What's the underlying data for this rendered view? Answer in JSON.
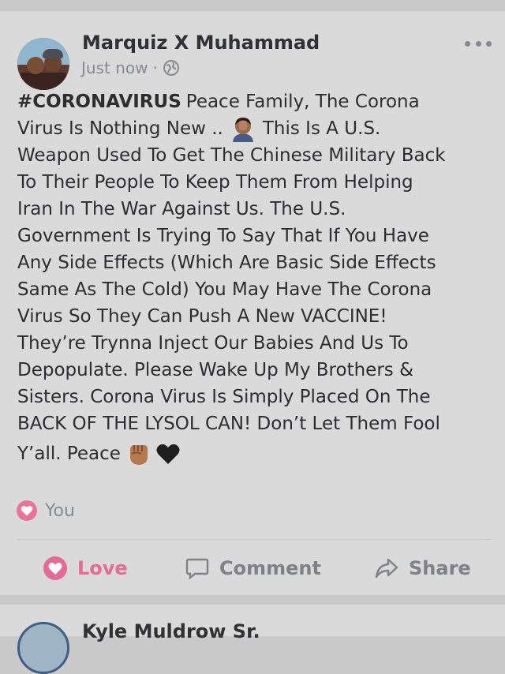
{
  "post": {
    "author": "Marquiz X Muhammad",
    "timestamp": "Just now",
    "separator": "·",
    "privacy_icon": "globe-icon",
    "more_icon": "more-options-icon",
    "hashtag": "#CORONAVIRUS",
    "lines": [
      "Peace Family, The Corona",
      "Virus Is Nothing New ..",
      "This Is A U.S.",
      "Weapon Used To Get The Chinese Military Back",
      "To Their People To Keep Them From Helping",
      "Iran In The War Against Us. The U.S.",
      "Government Is Trying To Say That If You Have",
      "Any Side Effects (Which Are Basic Side Effects",
      "Same As The Cold) You May Have The Corona",
      "Virus So They Can Push A New VACCINE!",
      "They’re Trynna Inject Our Babies And Us To",
      "Depopulate. Please Wake Up My Brothers &",
      "Sisters. Corona Virus Is Simply Placed On The",
      "BACK OF THE LYSOL CAN! Don’t Let Them Fool",
      "Y’all. Peace"
    ],
    "emojis": [
      "face-palm-emoji",
      "raised-fist-emoji",
      "black-heart-emoji"
    ]
  },
  "reactions": {
    "icon": "heart-reaction-icon",
    "label": "You"
  },
  "actions": {
    "love": "Love",
    "comment": "Comment",
    "share": "Share"
  },
  "next_post": {
    "author": "Kyle Muldrow Sr."
  },
  "colors": {
    "love": "#e36b95",
    "muted": "#7d8289",
    "text": "#2b2d31"
  }
}
